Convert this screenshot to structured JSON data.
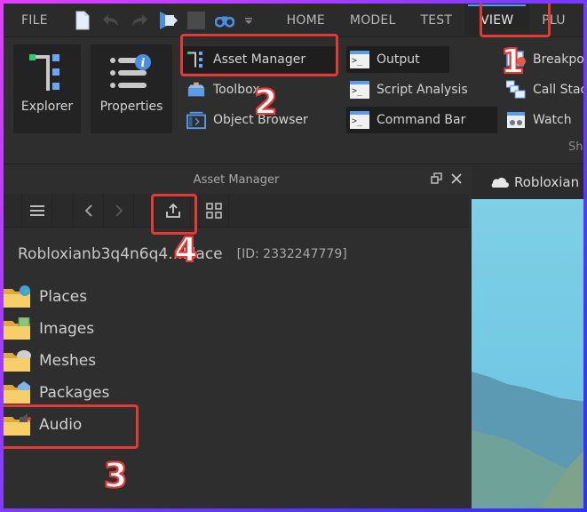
{
  "menubar": {
    "file_label": "FILE",
    "quick_access_icons": [
      "new-file-icon",
      "undo-icon",
      "redo-icon",
      "publish-icon",
      "stop-icon",
      "find-icon",
      "customize-icon"
    ],
    "tabs": [
      {
        "label": "HOME",
        "active": false
      },
      {
        "label": "MODEL",
        "active": false
      },
      {
        "label": "TEST",
        "active": false
      },
      {
        "label": "VIEW",
        "active": true
      },
      {
        "label": "PLU",
        "active": false
      }
    ]
  },
  "ribbon": {
    "explorer_label": "Explorer",
    "properties_label": "Properties",
    "asset_manager_label": "Asset Manager",
    "toolbox_label": "Toolbox",
    "object_browser_label": "Object Browser",
    "output_label": "Output",
    "script_analysis_label": "Script Analysis",
    "command_bar_label": "Command Bar",
    "breakpoints_label": "Breakpo",
    "call_stack_label": "Call Stac",
    "watch_label": "Watch",
    "section_label": "Sh"
  },
  "asset_manager": {
    "title": "Asset Manager",
    "place_name": "Robloxianb3q4n6q4...Place",
    "place_id": "[ID: 2332247779]",
    "folders": [
      {
        "label": "Places",
        "icon": "places-folder-icon"
      },
      {
        "label": "Images",
        "icon": "images-folder-icon"
      },
      {
        "label": "Meshes",
        "icon": "meshes-folder-icon"
      },
      {
        "label": "Packages",
        "icon": "packages-folder-icon"
      },
      {
        "label": "Audio",
        "icon": "audio-folder-icon"
      }
    ]
  },
  "viewport": {
    "tab_label": "Robloxian"
  },
  "annotations": {
    "step1": "1",
    "step2": "2",
    "step3": "3",
    "step4": "4",
    "highlight_color": "#e53935"
  }
}
